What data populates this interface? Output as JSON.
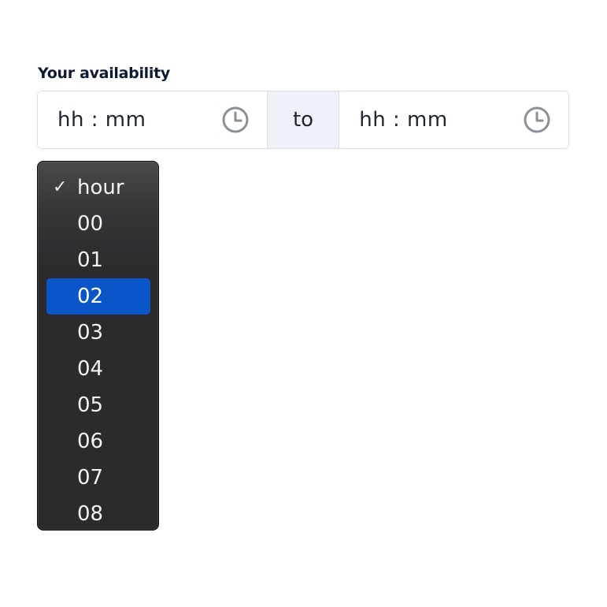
{
  "form": {
    "label": "Your availability",
    "start_time": {
      "placeholder": "hh : mm"
    },
    "separator": "to",
    "end_time": {
      "placeholder": "hh : mm"
    }
  },
  "hour_dropdown": {
    "checked_label": "hour",
    "check_mark": "✓",
    "highlighted": "02",
    "options": [
      "hour",
      "00",
      "01",
      "02",
      "03",
      "04",
      "05",
      "06",
      "07",
      "08"
    ]
  },
  "colors": {
    "label_text": "#0f1b33",
    "field_border": "#dcdfe4",
    "separator_bg": "#eef1f8",
    "clock_icon": "#8a9099",
    "dropdown_bg": "#2b2b2e",
    "highlight": "#0a56c8"
  },
  "icons": {
    "start_clock": "clock-icon",
    "end_clock": "clock-icon",
    "check": "checkmark-icon"
  }
}
